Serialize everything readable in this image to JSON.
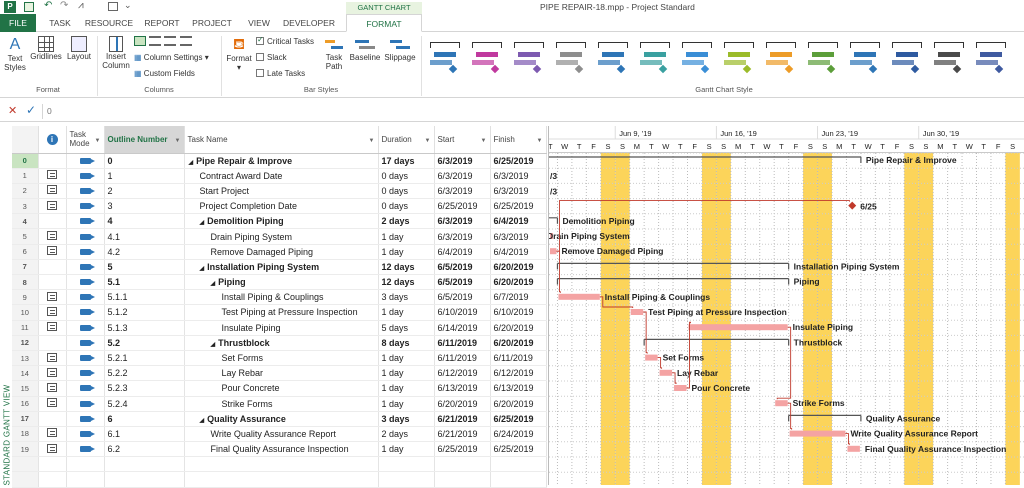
{
  "window": {
    "title": "PIPE REPAIR-18.mpp - Project Standard",
    "app_badge": "P"
  },
  "ribbon_tabs": {
    "context_label": "GANTT CHART TOOLS",
    "tabs": [
      "FILE",
      "TASK",
      "RESOURCE",
      "REPORT",
      "PROJECT",
      "VIEW",
      "DEVELOPER",
      "FORMAT"
    ],
    "active": "FORMAT"
  },
  "ribbon": {
    "format_group": {
      "label": "Format",
      "text_styles": "Text Styles",
      "gridlines": "Gridlines",
      "layout": "Layout"
    },
    "columns_group": {
      "label": "Columns",
      "insert_column": "Insert Column",
      "column_settings": "Column Settings",
      "custom_fields": "Custom Fields"
    },
    "bar_styles_group": {
      "label": "Bar Styles",
      "format": "Format",
      "critical_tasks": "Critical Tasks",
      "slack": "Slack",
      "late_tasks": "Late Tasks",
      "task_path": "Task Path",
      "baseline": "Baseline",
      "slippage": "Slippage",
      "critical_checked": true,
      "slack_checked": false,
      "late_checked": false
    },
    "gantt_style_group": {
      "label": "Gantt Chart Style",
      "swatch_colors": [
        "#2e75b6",
        "#c0399e",
        "#7d5ab0",
        "#8e8e8e",
        "#2e75b6",
        "#3aa0a0",
        "#3a8ed6",
        "#9bbb2a",
        "#ed9c28",
        "#5c9e3a",
        "#2e75b6",
        "#2e5aa0",
        "#4a4a4a",
        "#3f5aa0"
      ]
    }
  },
  "formula_bar": {
    "value": "0",
    "cancel_icon": "x-icon",
    "enter_icon": "check-icon"
  },
  "side_label": "STANDARD GANTT VIEW",
  "grid": {
    "columns": {
      "info": "i-icon",
      "task_mode": "Task Mode",
      "outline": "Outline Number",
      "name": "Task Name",
      "duration": "Duration",
      "start": "Start",
      "finish": "Finish"
    },
    "rows": [
      {
        "id": "0",
        "outline": "0",
        "name": "Pipe Repair & Improve",
        "level": 0,
        "summary": true,
        "duration": "17 days",
        "start": "6/3/2019",
        "finish": "6/25/2019",
        "info_icon": false
      },
      {
        "id": "1",
        "outline": "1",
        "name": "Contract Award Date",
        "level": 1,
        "summary": false,
        "duration": "0 days",
        "start": "6/3/2019",
        "finish": "6/3/2019",
        "info_icon": true
      },
      {
        "id": "2",
        "outline": "2",
        "name": "Start Project",
        "level": 1,
        "summary": false,
        "duration": "0 days",
        "start": "6/3/2019",
        "finish": "6/3/2019",
        "info_icon": true
      },
      {
        "id": "3",
        "outline": "3",
        "name": "Project Completion Date",
        "level": 1,
        "summary": false,
        "duration": "0 days",
        "start": "6/25/2019",
        "finish": "6/25/2019",
        "info_icon": true
      },
      {
        "id": "4",
        "outline": "4",
        "name": "Demolition Piping",
        "level": 1,
        "summary": true,
        "duration": "2 days",
        "start": "6/3/2019",
        "finish": "6/4/2019",
        "info_icon": false
      },
      {
        "id": "5",
        "outline": "4.1",
        "name": "Drain Piping System",
        "level": 2,
        "summary": false,
        "duration": "1 day",
        "start": "6/3/2019",
        "finish": "6/3/2019",
        "info_icon": true
      },
      {
        "id": "6",
        "outline": "4.2",
        "name": "Remove Damaged Piping",
        "level": 2,
        "summary": false,
        "duration": "1 day",
        "start": "6/4/2019",
        "finish": "6/4/2019",
        "info_icon": true
      },
      {
        "id": "7",
        "outline": "5",
        "name": "Installation Piping System",
        "level": 1,
        "summary": true,
        "duration": "12 days",
        "start": "6/5/2019",
        "finish": "6/20/2019",
        "info_icon": false
      },
      {
        "id": "8",
        "outline": "5.1",
        "name": "Piping",
        "level": 2,
        "summary": true,
        "duration": "12 days",
        "start": "6/5/2019",
        "finish": "6/20/2019",
        "info_icon": false
      },
      {
        "id": "9",
        "outline": "5.1.1",
        "name": "Install Piping & Couplings",
        "level": 3,
        "summary": false,
        "duration": "3 days",
        "start": "6/5/2019",
        "finish": "6/7/2019",
        "info_icon": true
      },
      {
        "id": "10",
        "outline": "5.1.2",
        "name": "Test Piping at Pressure Inspection",
        "level": 3,
        "summary": false,
        "duration": "1 day",
        "start": "6/10/2019",
        "finish": "6/10/2019",
        "info_icon": true
      },
      {
        "id": "11",
        "outline": "5.1.3",
        "name": "Insulate Piping",
        "level": 3,
        "summary": false,
        "duration": "5 days",
        "start": "6/14/2019",
        "finish": "6/20/2019",
        "info_icon": true
      },
      {
        "id": "12",
        "outline": "5.2",
        "name": "Thrustblock",
        "level": 2,
        "summary": true,
        "duration": "8 days",
        "start": "6/11/2019",
        "finish": "6/20/2019",
        "info_icon": false
      },
      {
        "id": "13",
        "outline": "5.2.1",
        "name": "Set Forms",
        "level": 3,
        "summary": false,
        "duration": "1 day",
        "start": "6/11/2019",
        "finish": "6/11/2019",
        "info_icon": true
      },
      {
        "id": "14",
        "outline": "5.2.2",
        "name": "Lay Rebar",
        "level": 3,
        "summary": false,
        "duration": "1 day",
        "start": "6/12/2019",
        "finish": "6/12/2019",
        "info_icon": true
      },
      {
        "id": "15",
        "outline": "5.2.3",
        "name": "Pour Concrete",
        "level": 3,
        "summary": false,
        "duration": "1 day",
        "start": "6/13/2019",
        "finish": "6/13/2019",
        "info_icon": true
      },
      {
        "id": "16",
        "outline": "5.2.4",
        "name": "Strike Forms",
        "level": 3,
        "summary": false,
        "duration": "1 day",
        "start": "6/20/2019",
        "finish": "6/20/2019",
        "info_icon": true
      },
      {
        "id": "17",
        "outline": "6",
        "name": "Quality Assurance",
        "level": 1,
        "summary": true,
        "duration": "3 days",
        "start": "6/21/2019",
        "finish": "6/25/2019",
        "info_icon": false
      },
      {
        "id": "18",
        "outline": "6.1",
        "name": "Write Quality Assurance Report",
        "level": 2,
        "summary": false,
        "duration": "2 days",
        "start": "6/21/2019",
        "finish": "6/24/2019",
        "info_icon": true
      },
      {
        "id": "19",
        "outline": "6.2",
        "name": "Final Quality Assurance Inspection",
        "level": 2,
        "summary": false,
        "duration": "1 day",
        "start": "6/25/2019",
        "finish": "6/25/2019",
        "info_icon": true
      }
    ]
  },
  "gantt": {
    "weeks": [
      "19",
      "Jun 9, '19",
      "Jun 16, '19",
      "Jun 23, '19",
      "Jun 30, '19"
    ],
    "day_letters": [
      "T",
      "W",
      "T",
      "F",
      "S",
      "S",
      "M",
      "T",
      "W",
      "T",
      "F",
      "S",
      "S",
      "M",
      "T",
      "W",
      "T",
      "F",
      "S",
      "S",
      "M",
      "T",
      "W",
      "T",
      "F",
      "S",
      "S",
      "M",
      "T",
      "W",
      "T",
      "F",
      "S"
    ],
    "bar_color": "#f4a3a3",
    "weekend_color": "#fcd45a",
    "summary_color": "#555555",
    "milestone_color": "#c0392b",
    "bars": [
      {
        "row": 0,
        "type": "summary",
        "label": "Pipe Repair & Improve"
      },
      {
        "row": 1,
        "type": "milestone-cut",
        "label": "/3"
      },
      {
        "row": 2,
        "type": "milestone-cut",
        "label": "/3"
      },
      {
        "row": 3,
        "type": "milestone",
        "label": "6/25"
      },
      {
        "row": 4,
        "type": "summary",
        "label": "Demolition Piping"
      },
      {
        "row": 5,
        "type": "task",
        "label": "Drain Piping System"
      },
      {
        "row": 6,
        "type": "task",
        "label": "Remove Damaged Piping"
      },
      {
        "row": 7,
        "type": "summary",
        "label": "Installation Piping System"
      },
      {
        "row": 8,
        "type": "summary",
        "label": "Piping"
      },
      {
        "row": 9,
        "type": "task",
        "label": "Install Piping & Couplings"
      },
      {
        "row": 10,
        "type": "task",
        "label": "Test Piping at Pressure Inspection"
      },
      {
        "row": 11,
        "type": "task",
        "label": "Insulate Piping"
      },
      {
        "row": 12,
        "type": "summary",
        "label": "Thrustblock"
      },
      {
        "row": 13,
        "type": "task",
        "label": "Set Forms"
      },
      {
        "row": 14,
        "type": "task",
        "label": "Lay Rebar"
      },
      {
        "row": 15,
        "type": "task",
        "label": "Pour Concrete"
      },
      {
        "row": 16,
        "type": "task",
        "label": "Strike Forms"
      },
      {
        "row": 17,
        "type": "summary",
        "label": "Quality Assurance"
      },
      {
        "row": 18,
        "type": "task",
        "label": "Write Quality Assurance Report"
      },
      {
        "row": 19,
        "type": "task",
        "label": "Final Quality Assurance Inspection"
      }
    ]
  }
}
